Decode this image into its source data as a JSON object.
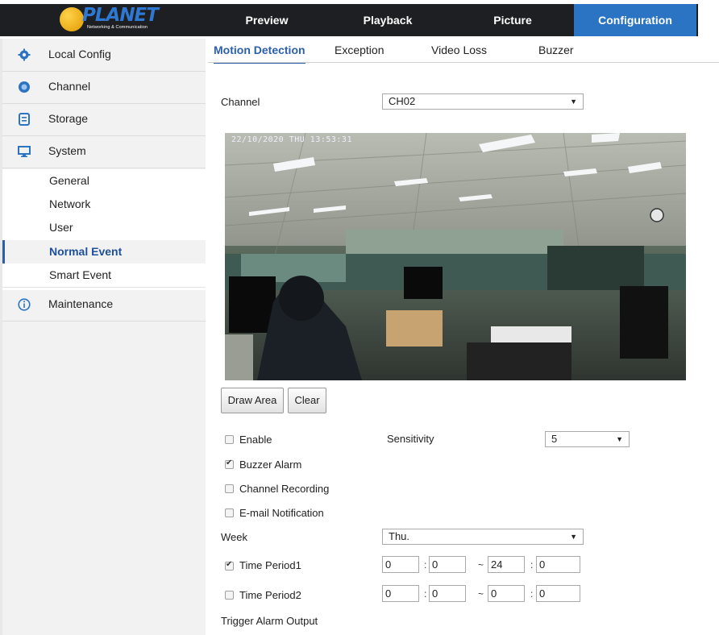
{
  "logo": {
    "word": "PLANET",
    "sub": "Networking & Communication"
  },
  "nav": {
    "tabs": [
      "Preview",
      "Playback",
      "Picture",
      "Configuration"
    ],
    "active": "Configuration"
  },
  "sidebar": {
    "items": [
      {
        "label": "Local Config",
        "icon": "gear-icon"
      },
      {
        "label": "Channel",
        "icon": "camera-icon"
      },
      {
        "label": "Storage",
        "icon": "storage-icon"
      },
      {
        "label": "System",
        "icon": "monitor-icon"
      },
      {
        "label": "Maintenance",
        "icon": "info-icon"
      }
    ],
    "subitems": [
      "General",
      "Network",
      "User",
      "Normal Event",
      "Smart Event"
    ],
    "active_subitem": "Normal Event"
  },
  "content_tabs": {
    "tabs": [
      "Motion Detection",
      "Exception",
      "Video Loss",
      "Buzzer"
    ],
    "active": "Motion Detection"
  },
  "channel": {
    "label": "Channel",
    "value": "CH02"
  },
  "video": {
    "timestamp": "22/10/2020 THU 13:53:31"
  },
  "buttons": {
    "draw_area": "Draw Area",
    "clear": "Clear"
  },
  "options": {
    "enable": {
      "label": "Enable",
      "checked": false
    },
    "buzzer_alarm": {
      "label": "Buzzer Alarm",
      "checked": true
    },
    "channel_recording": {
      "label": "Channel Recording",
      "checked": false
    },
    "email_notification": {
      "label": "E-mail Notification",
      "checked": false
    }
  },
  "sensitivity": {
    "label": "Sensitivity",
    "value": "5"
  },
  "week": {
    "label": "Week",
    "value": "Thu."
  },
  "time_period1": {
    "label": "Time Period1",
    "checked": true,
    "start_h": "0",
    "start_m": "0",
    "end_h": "24",
    "end_m": "0"
  },
  "time_period2": {
    "label": "Time Period2",
    "checked": false,
    "start_h": "0",
    "start_m": "0",
    "end_h": "0",
    "end_m": "0"
  },
  "separators": {
    "colon": ":",
    "tilde": "~"
  },
  "trigger_alarm_output": {
    "label": "Trigger Alarm Output"
  },
  "colors": {
    "nav_bg": "#1e1f22",
    "nav_active": "#2b74c4",
    "accent": "#2b5fa8",
    "sidebar_bg": "#f2f2f2"
  }
}
